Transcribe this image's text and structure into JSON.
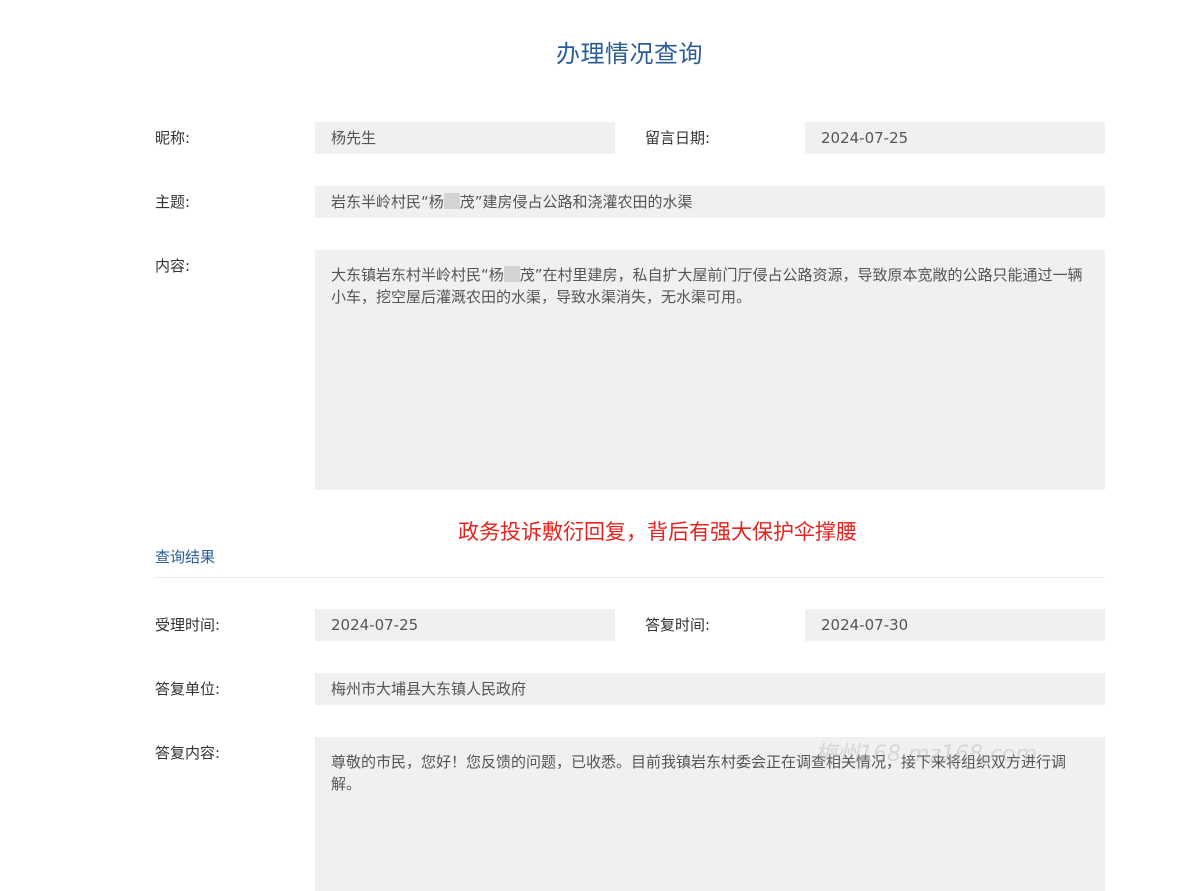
{
  "page": {
    "title": "办理情况查询"
  },
  "message": {
    "nickname_label": "昵称:",
    "nickname": "杨先生",
    "date_label": "留言日期:",
    "date": "2024-07-25",
    "subject_label": "主题:",
    "subject_before": "岩东半岭村民“杨",
    "subject_after": "茂”建房侵占公路和浇灌农田的水渠",
    "content_label": "内容:",
    "content_before": "大东镇岩东村半岭村民“杨",
    "content_after": "茂”在村里建房，私自扩大屋前门厅侵占公路资源，导致原本宽敞的公路只能通过一辆小车，挖空屋后灌溉农田的水渠，导致水渠消失，无水渠可用。"
  },
  "notice": {
    "text": "政务投诉敷衍回复，背后有强大保护伞撑腰",
    "color": "#e8231f"
  },
  "result": {
    "section_title": "查询结果",
    "accept_time_label": "受理时间:",
    "accept_time": "2024-07-25",
    "reply_time_label": "答复时间:",
    "reply_time": "2024-07-30",
    "reply_unit_label": "答复单位:",
    "reply_unit": "梅州市大埔县大东镇人民政府",
    "reply_content_label": "答复内容:",
    "reply_content": "尊敬的市民，您好！您反馈的问题，已收悉。目前我镇岩东村委会正在调查相关情况，接下来将组织双方进行调解。"
  },
  "watermark": {
    "text": "梅州168 mz168.com"
  },
  "colors": {
    "accent": "#2a5c9a",
    "field_bg": "#f0f0f0"
  }
}
